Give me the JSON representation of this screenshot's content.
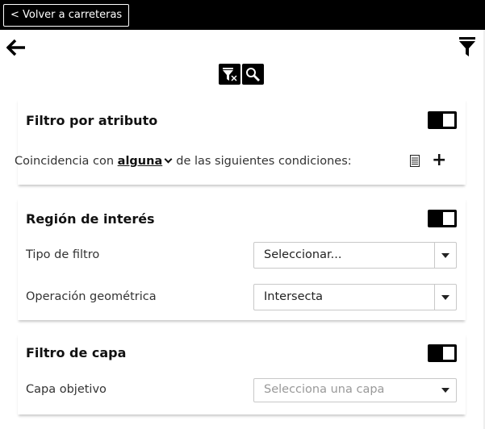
{
  "header": {
    "back_label": "< Volver a carreteras"
  },
  "icons": {
    "nav": "arrow-left-icon",
    "filter": "filter-icon",
    "clear_filter": "filter-clear-icon",
    "search": "search-icon",
    "table": "table-icon",
    "add": "plus-icon"
  },
  "attribute_filter": {
    "title": "Filtro por atributo",
    "enabled": true,
    "prefix": "Coincidencia con",
    "match_mode": "alguna",
    "suffix": "de las siguientes condiciones:",
    "add_symbol": "+"
  },
  "region_of_interest": {
    "title": "Región de interés",
    "enabled": true,
    "filter_type_label": "Tipo de filtro",
    "filter_type_value": "Seleccionar...",
    "geom_op_label": "Operación geométrica",
    "geom_op_value": "Intersecta"
  },
  "layer_filter": {
    "title": "Filtro de capa",
    "enabled": true,
    "target_label": "Capa objetivo",
    "target_placeholder": "Selecciona una capa"
  }
}
